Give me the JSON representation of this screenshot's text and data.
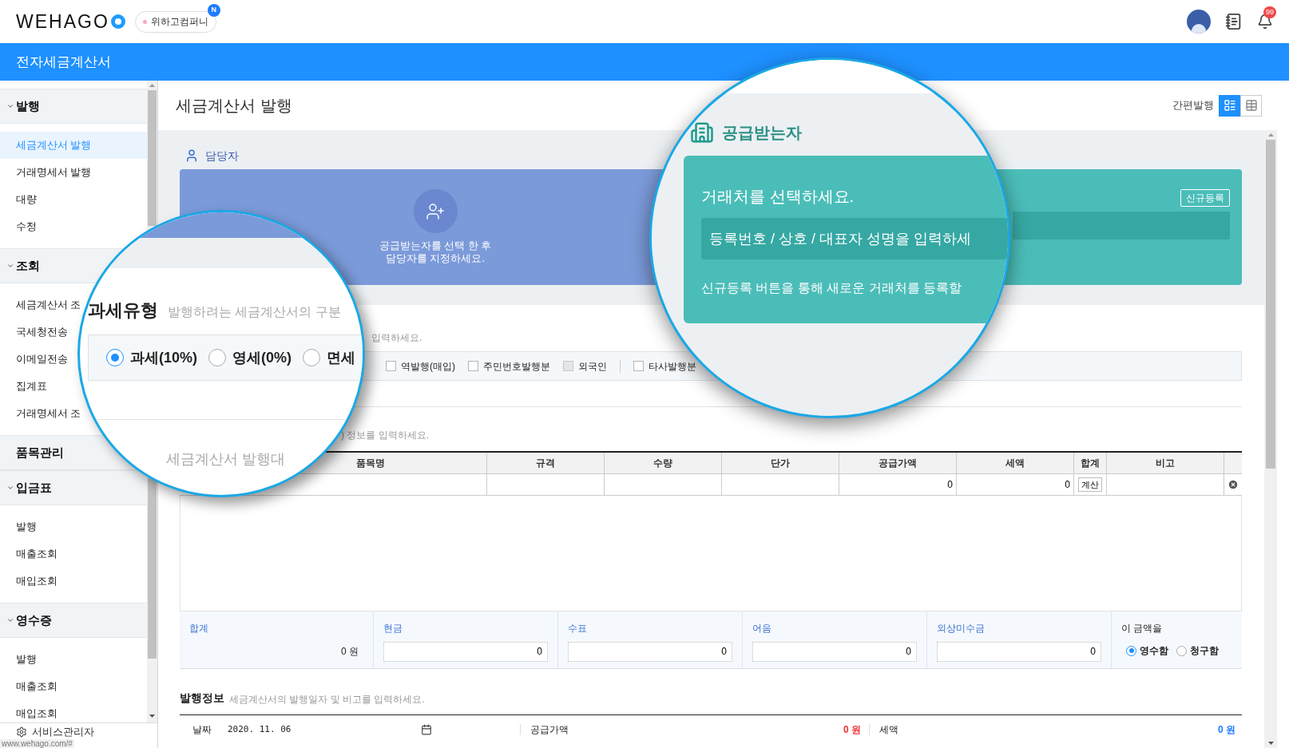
{
  "header": {
    "logo": "WEHAGO",
    "company": "위하고컴퍼니",
    "company_badge": "N",
    "notification_count": "99"
  },
  "app_bar": {
    "title": "전자세금계산서"
  },
  "sidebar": {
    "groups": [
      {
        "label": "발행",
        "kind": "group",
        "expanded": true,
        "items": [
          {
            "label": "세금계산서 발행",
            "selected": true
          },
          {
            "label": "거래명세서 발행",
            "selected": false
          },
          {
            "label": "대량",
            "selected": false
          },
          {
            "label": "수정",
            "selected": false
          }
        ]
      },
      {
        "label": "조회",
        "kind": "group",
        "expanded": true,
        "items": [
          {
            "label": "세금계산서 조",
            "selected": false
          },
          {
            "label": "국세청전송",
            "selected": false
          },
          {
            "label": "이메일전송",
            "selected": false
          },
          {
            "label": "집계표",
            "selected": false
          },
          {
            "label": "거래명세서 조",
            "selected": false
          }
        ]
      },
      {
        "label": "품목관리",
        "kind": "link"
      },
      {
        "label": "입금표",
        "kind": "group",
        "expanded": true,
        "items": [
          {
            "label": "발행",
            "selected": false
          },
          {
            "label": "매출조회",
            "selected": false
          },
          {
            "label": "매입조회",
            "selected": false
          }
        ]
      },
      {
        "label": "영수증",
        "kind": "group",
        "expanded": true,
        "items": [
          {
            "label": "발행",
            "selected": false
          },
          {
            "label": "매출조회",
            "selected": false
          },
          {
            "label": "매입조회",
            "selected": false
          }
        ]
      }
    ],
    "footer": "서비스관리자"
  },
  "page": {
    "title": "세금계산서 발행",
    "quick_issue_label": "간편발행",
    "views": [
      {
        "kind": "card",
        "selected": true
      },
      {
        "kind": "table",
        "selected": false
      }
    ]
  },
  "contact": {
    "title": "담당자",
    "message_lines": [
      "공급받는자를 선택 한 후",
      "담당자를 지정하세요."
    ]
  },
  "supplier": {
    "register_button": "신규등록"
  },
  "tax_type": {
    "description_tail": "입력하세요.",
    "options": [
      {
        "label": "역발행(매입)",
        "checked": false,
        "disabled": false
      },
      {
        "label": "주민번호발행분",
        "checked": false,
        "disabled": false
      },
      {
        "label": "외국인",
        "checked": false,
        "disabled": true
      },
      {
        "label": "타사발행분",
        "checked": false,
        "disabled": false
      }
    ]
  },
  "items": {
    "description_tail": ") 정보를 입력하세요.",
    "columns": [
      "품목명",
      "규격",
      "수량",
      "단가",
      "공급가액",
      "세액",
      "합계",
      "비고"
    ],
    "rows": [
      {
        "supply_amount": "0",
        "tax": "0",
        "calc_button": "계산"
      }
    ]
  },
  "summary": {
    "fields": [
      {
        "label": "합계",
        "kind": "text",
        "value": "0 원"
      },
      {
        "label": "현금",
        "kind": "input",
        "value": "0"
      },
      {
        "label": "수표",
        "kind": "input",
        "value": "0"
      },
      {
        "label": "어음",
        "kind": "input",
        "value": "0"
      },
      {
        "label": "외상미수금",
        "kind": "input",
        "value": "0"
      }
    ],
    "receipt_label": "이 금액을",
    "receipt_options": [
      {
        "label": "영수함",
        "selected": true
      },
      {
        "label": "청구함",
        "selected": false
      }
    ]
  },
  "issue_info": {
    "title": "발행정보",
    "description": "세금계산서의 발행일자 및 비고를 입력하세요.",
    "date_label": "날짜",
    "date": "2020. 11. 06",
    "supply_label": "공급가액",
    "supply_value": "0 원",
    "tax_label": "세액",
    "tax_value": "0 원"
  },
  "magnifier_left": {
    "title": "과세유형",
    "description": "발행하려는 세금계산서의 구분",
    "options": [
      {
        "label": "과세(10%)",
        "selected": true
      },
      {
        "label": "영세(0%)",
        "selected": false
      },
      {
        "label": "면세",
        "selected": false
      }
    ],
    "bottom_text": "세금계산서 발행대"
  },
  "magnifier_right": {
    "title": "공급받는자",
    "prompt": "거래처를 선택하세요.",
    "search_placeholder": "등록번호 / 상호 / 대표자 성명을 입력하세",
    "hint": "신규등록 버튼을 통해 새로운 거래처를 등록할"
  },
  "status_url": "www.wehago.com/#"
}
